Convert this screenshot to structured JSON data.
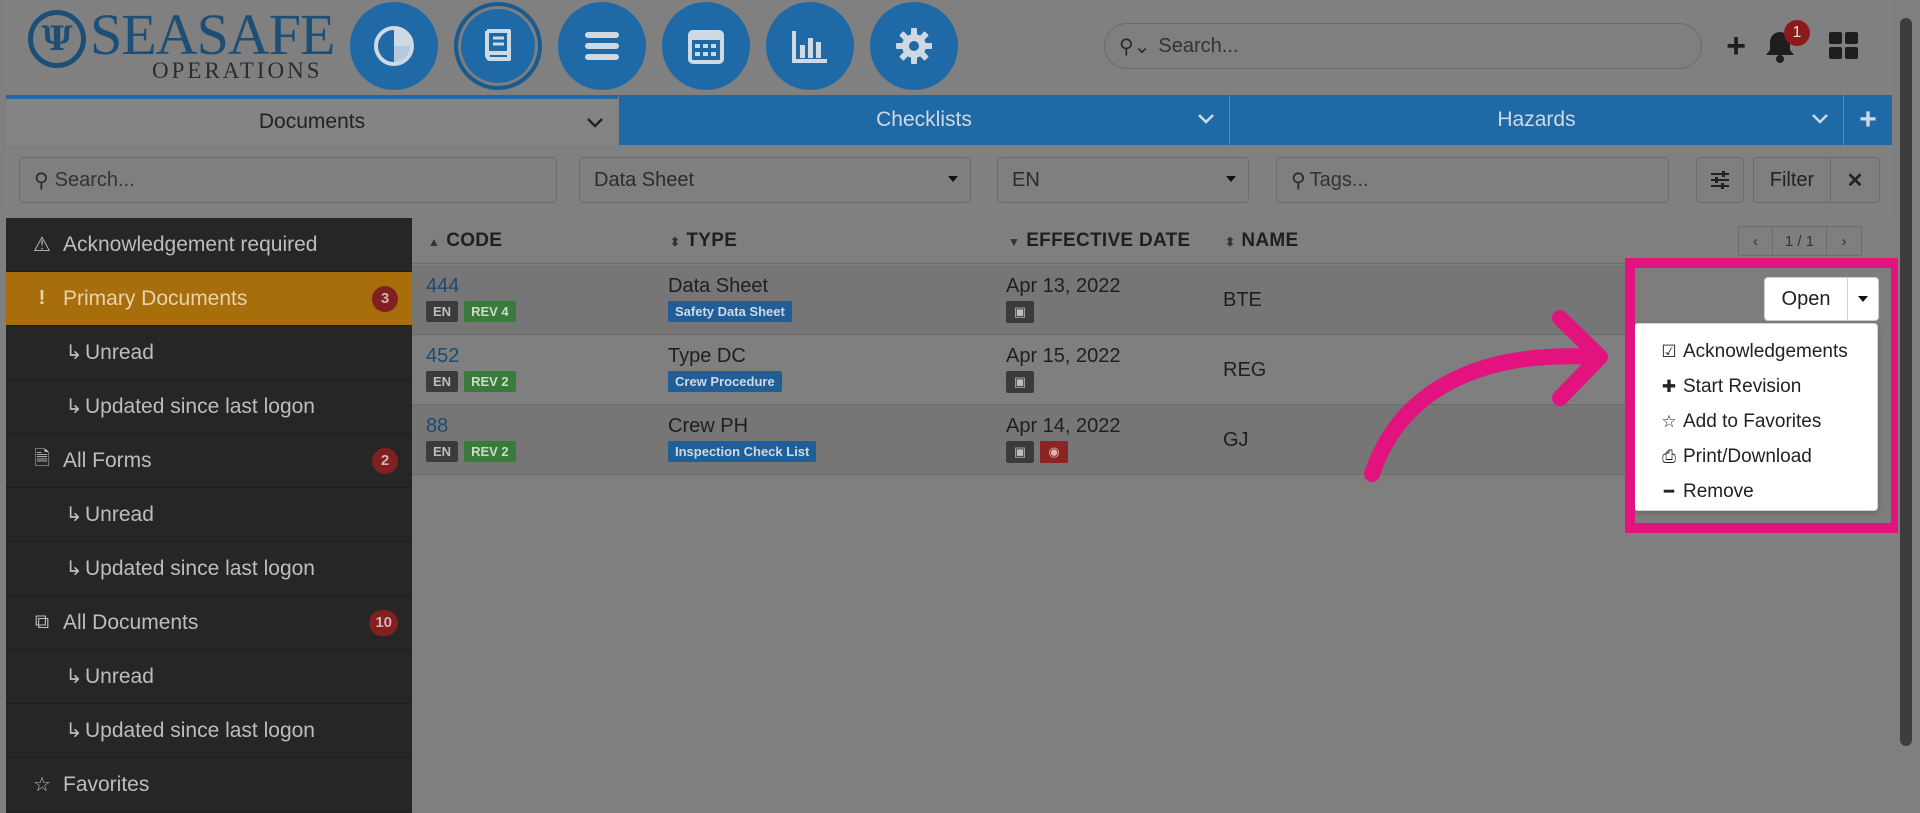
{
  "brand": {
    "name": "SEASAFE",
    "subtitle": "OPERATIONS",
    "logo_letter": "Ψ"
  },
  "nav": [
    {
      "name": "dashboard-nav-button",
      "icon": "pie-chart-icon"
    },
    {
      "name": "documents-nav-button",
      "icon": "book-icon"
    },
    {
      "name": "menu-nav-button",
      "icon": "list-icon"
    },
    {
      "name": "calendar-nav-button",
      "icon": "calendar-icon"
    },
    {
      "name": "reports-nav-button",
      "icon": "bar-chart-icon"
    },
    {
      "name": "settings-nav-button",
      "icon": "gear-icon"
    }
  ],
  "global_search": {
    "placeholder": "Search..."
  },
  "notifications": {
    "count": "1"
  },
  "tabs": [
    {
      "label": "Documents",
      "active": true
    },
    {
      "label": "Checklists",
      "active": false
    },
    {
      "label": "Hazards",
      "active": false
    }
  ],
  "filters": {
    "search_placeholder": "Search...",
    "type_value": "Data Sheet",
    "language_value": "EN",
    "tags_placeholder": "Tags...",
    "filter_label": "Filter",
    "clear_label": "✕"
  },
  "sidebar": {
    "items": [
      {
        "label": "Acknowledgement required",
        "icon": "warning-icon",
        "badge": ""
      },
      {
        "label": "Primary Documents",
        "icon": "exclamation-icon",
        "badge": "3",
        "active": true
      },
      {
        "label": "Unread",
        "icon": "subitem-arrow-icon",
        "sub": true
      },
      {
        "label": "Updated since last logon",
        "icon": "subitem-arrow-icon",
        "sub": true
      },
      {
        "label": "All Forms",
        "icon": "file-icon",
        "badge": "2"
      },
      {
        "label": "Unread",
        "icon": "subitem-arrow-icon",
        "sub": true
      },
      {
        "label": "Updated since last logon",
        "icon": "subitem-arrow-icon",
        "sub": true
      },
      {
        "label": "All Documents",
        "icon": "copy-icon",
        "badge": "10"
      },
      {
        "label": "Unread",
        "icon": "subitem-arrow-icon",
        "sub": true
      },
      {
        "label": "Updated since last logon",
        "icon": "subitem-arrow-icon",
        "sub": true
      },
      {
        "label": "Favorites",
        "icon": "star-icon",
        "badge": ""
      }
    ]
  },
  "table": {
    "columns": {
      "code": "CODE",
      "type": "TYPE",
      "effective_date": "EFFECTIVE DATE",
      "name": "NAME"
    },
    "pager": {
      "prev": "‹",
      "page": "1 / 1",
      "next": "›"
    },
    "rows": [
      {
        "code": "444",
        "lang": "EN",
        "rev": "REV 4",
        "type": "Data Sheet",
        "type_tag": "Safety Data Sheet",
        "date": "Apr 13, 2022",
        "hidden": false,
        "name": "BTE"
      },
      {
        "code": "452",
        "lang": "EN",
        "rev": "REV 2",
        "type": "Type DC",
        "type_tag": "Crew Procedure",
        "date": "Apr 15, 2022",
        "hidden": false,
        "name": "REG"
      },
      {
        "code": "88",
        "lang": "EN",
        "rev": "REV 2",
        "type": "Crew PH",
        "type_tag": "Inspection Check List",
        "date": "Apr 14, 2022",
        "hidden": true,
        "name": "GJ"
      }
    ]
  },
  "popup": {
    "open_label": "Open",
    "menu": [
      {
        "label": "Acknowledgements",
        "icon": "checkbox-icon",
        "glyph": "☑"
      },
      {
        "label": "Start Revision",
        "icon": "plus-icon",
        "glyph": "✚"
      },
      {
        "label": "Add to Favorites",
        "icon": "star-outline-icon",
        "glyph": "☆"
      },
      {
        "label": "Print/Download",
        "icon": "printer-icon",
        "glyph": "⎙"
      },
      {
        "label": "Remove",
        "icon": "minus-icon",
        "glyph": "━"
      }
    ]
  },
  "colors": {
    "accent": "#1f6aa6",
    "active_sidebar": "#a76e0b",
    "highlight": "#e2127f"
  }
}
